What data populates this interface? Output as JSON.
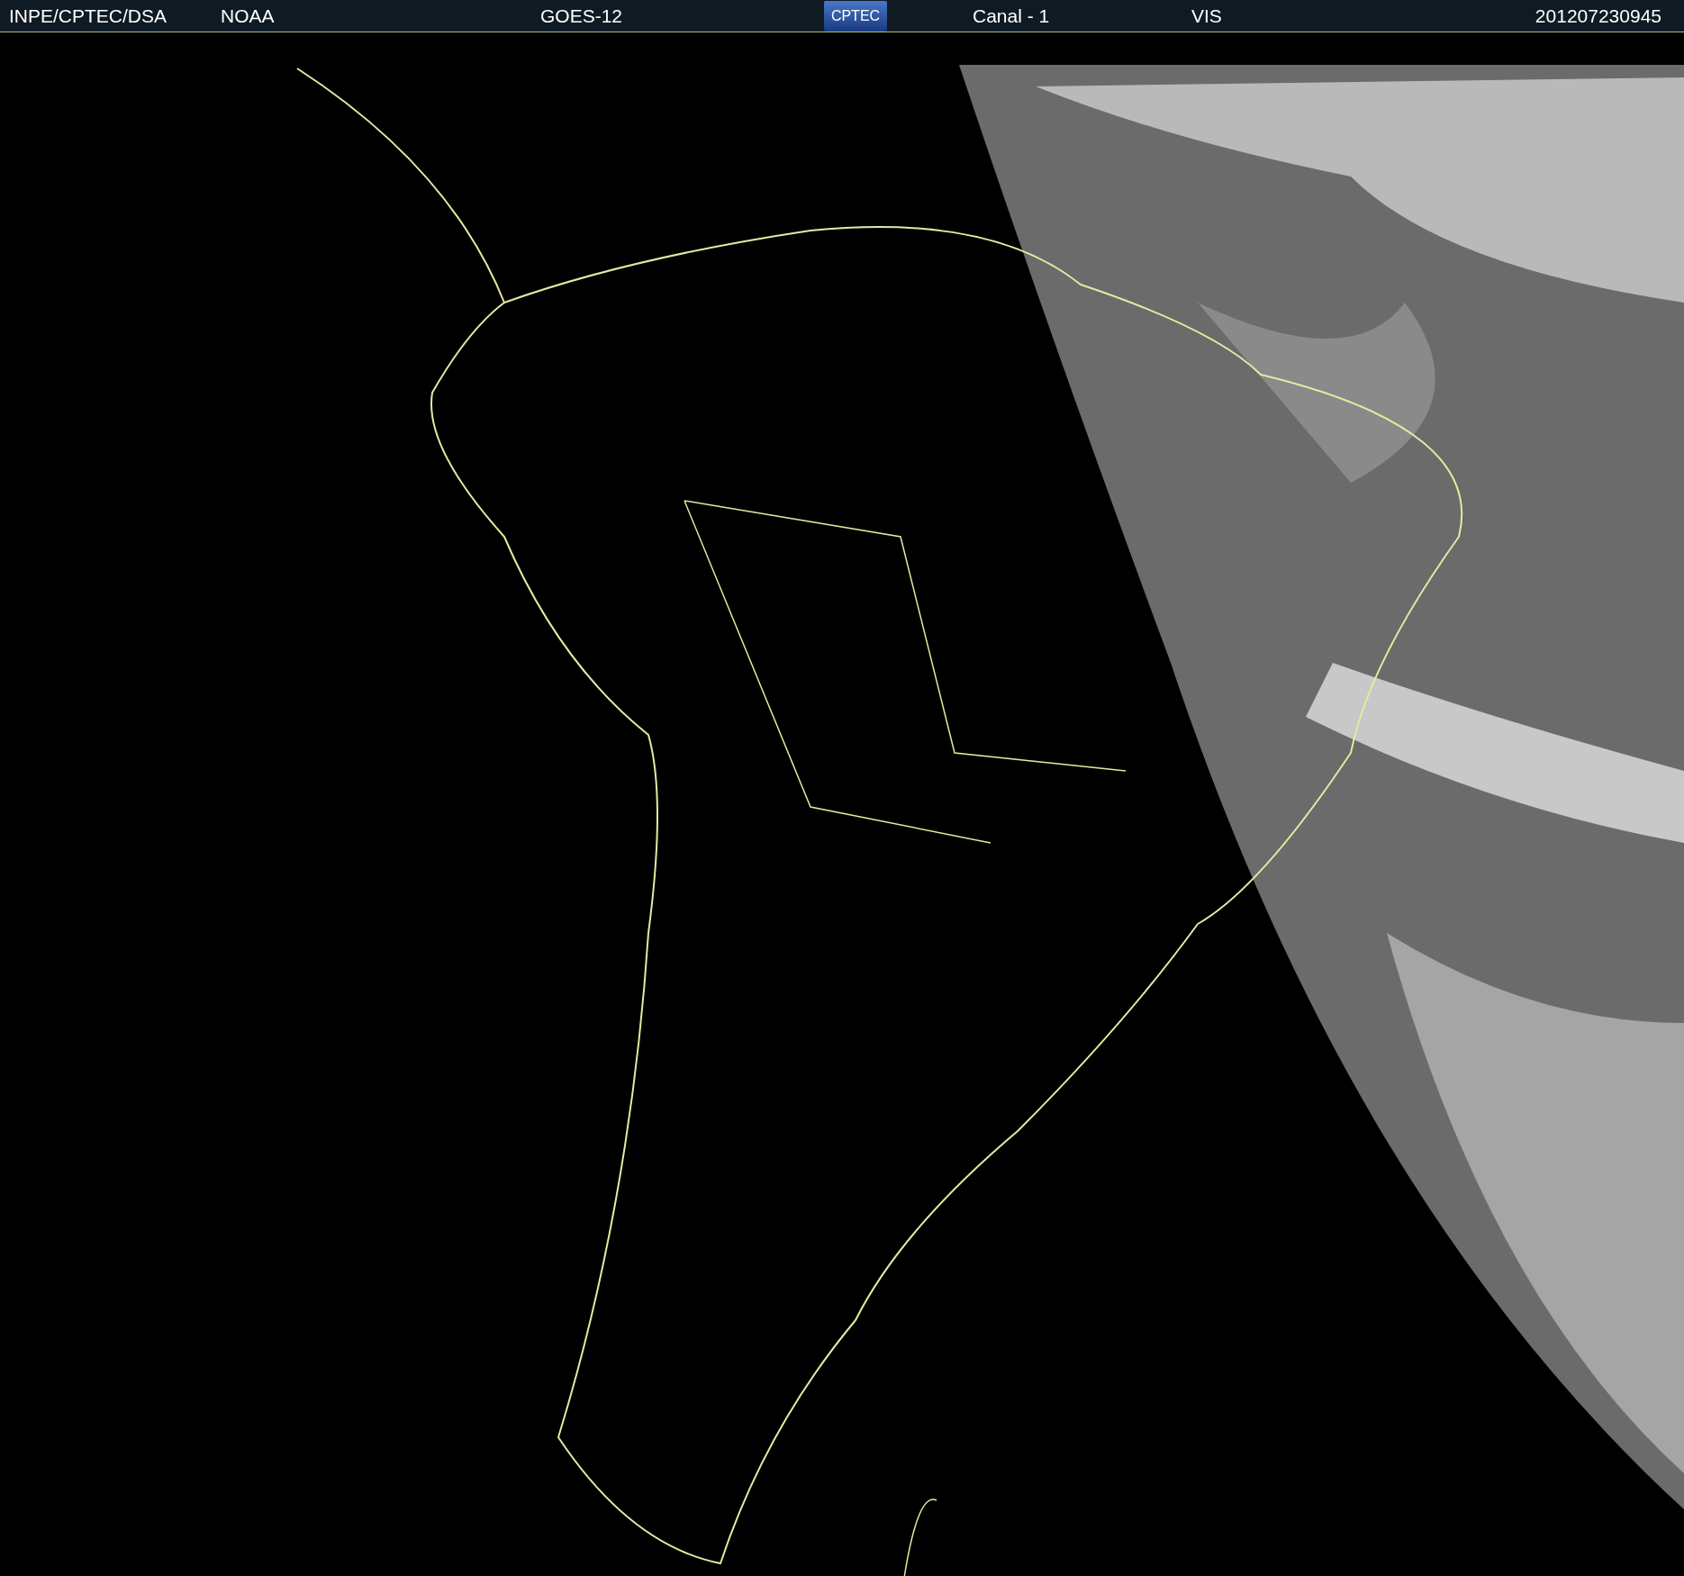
{
  "header": {
    "source": "INPE/CPTEC/DSA",
    "agency": "NOAA",
    "satellite": "GOES-12",
    "logo": "CPTEC",
    "channel": "Canal - 1",
    "band": "VIS",
    "timestamp": "201207230945"
  }
}
